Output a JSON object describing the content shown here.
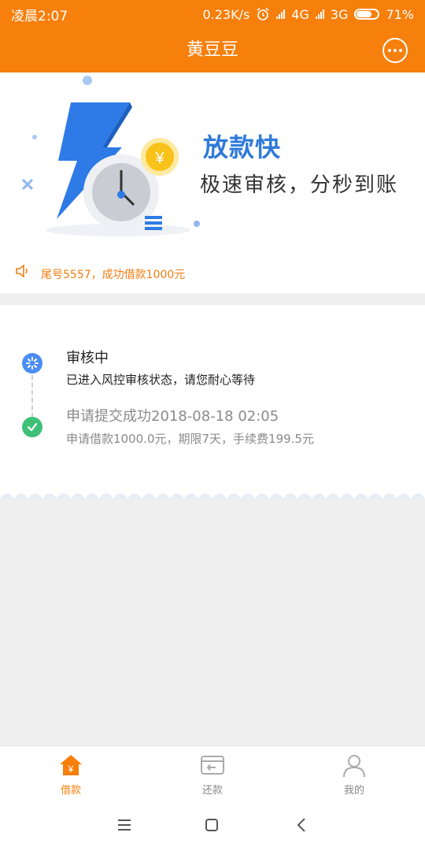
{
  "status_bar": {
    "time": "凌晨2:07",
    "speed": "0.23K/s",
    "network_1": "4G",
    "network_2": "3G",
    "battery": "71%",
    "battery_level": 0.71
  },
  "header": {
    "title": "黄豆豆"
  },
  "banner": {
    "title": "放款快",
    "subtitle": "极速审核，分秒到账",
    "coin_symbol": "¥"
  },
  "ticker": {
    "text": "尾号5557，成功借款1000元"
  },
  "timeline": {
    "steps": [
      {
        "title": "审核中",
        "desc": "已进入风控审核状态，请您耐心等待"
      },
      {
        "title": "申请提交成功2018-08-18 02:05",
        "desc": "申请借款1000.0元，期限7天，手续费199.5元"
      }
    ]
  },
  "bottom_nav": {
    "items": [
      {
        "label": "借款",
        "icon": "home-yen-icon",
        "active": true
      },
      {
        "label": "还款",
        "icon": "repay-card-icon",
        "active": false
      },
      {
        "label": "我的",
        "icon": "user-icon",
        "active": false
      }
    ]
  },
  "colors": {
    "brand": "#f77f0b",
    "accent_blue": "#2f7ad9",
    "success": "#3fc079",
    "ticker": "#f07d10"
  }
}
